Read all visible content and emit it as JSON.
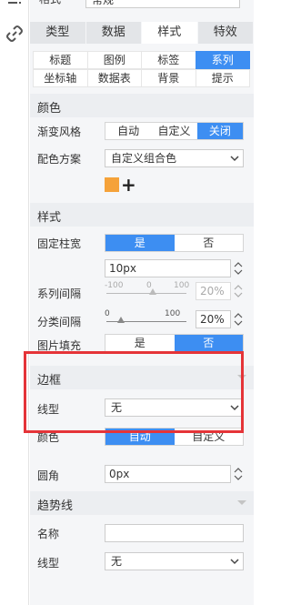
{
  "top_field": {
    "label": "格式",
    "value": "常规"
  },
  "tabs": [
    {
      "label": "类型",
      "active": false
    },
    {
      "label": "数据",
      "active": false
    },
    {
      "label": "样式",
      "active": true
    },
    {
      "label": "特效",
      "active": false
    }
  ],
  "subtabs": {
    "row1": [
      {
        "label": "标题",
        "active": false
      },
      {
        "label": "图例",
        "active": false
      },
      {
        "label": "标签",
        "active": false
      },
      {
        "label": "系列",
        "active": true
      }
    ],
    "row2": [
      {
        "label": "坐标轴",
        "active": false
      },
      {
        "label": "数据表",
        "active": false
      },
      {
        "label": "背景",
        "active": false
      },
      {
        "label": "提示",
        "active": false
      }
    ]
  },
  "color_section": {
    "title": "颜色",
    "gradient": {
      "label": "渐变风格",
      "options": [
        "自动",
        "自定义",
        "关闭"
      ],
      "selected": "关闭"
    },
    "scheme": {
      "label": "配色方案",
      "value": "自定义组合色"
    },
    "swatch_color": "#f5a23a"
  },
  "style_section": {
    "title": "样式",
    "fixed_width": {
      "label": "固定柱宽",
      "options": [
        "是",
        "否"
      ],
      "selected": "是"
    },
    "width_value": "10px",
    "series_gap": {
      "label": "系列间隔",
      "min": "-100",
      "mid": "0",
      "max": "100",
      "value": "20%",
      "level": 0.6,
      "disabled": true
    },
    "category_gap": {
      "label": "分类间隔",
      "min": "0",
      "max": "100",
      "value": "20%",
      "level": 0.2,
      "disabled": false
    },
    "image_fill": {
      "label": "图片填充",
      "options": [
        "是",
        "否"
      ],
      "selected": "否"
    }
  },
  "border_section": {
    "title": "边框",
    "line_type": {
      "label": "线型",
      "value": "无"
    },
    "color": {
      "label": "颜色",
      "options": [
        "自动",
        "自定义"
      ],
      "selected": "自动"
    },
    "radius": {
      "label": "圆角",
      "value": "0px"
    }
  },
  "trend_section": {
    "title": "趋势线",
    "name": {
      "label": "名称",
      "value": ""
    },
    "line_type": {
      "label": "线型",
      "value": "无"
    }
  },
  "colors": {
    "accent": "#3d8ef2",
    "highlight": "#e53438"
  }
}
